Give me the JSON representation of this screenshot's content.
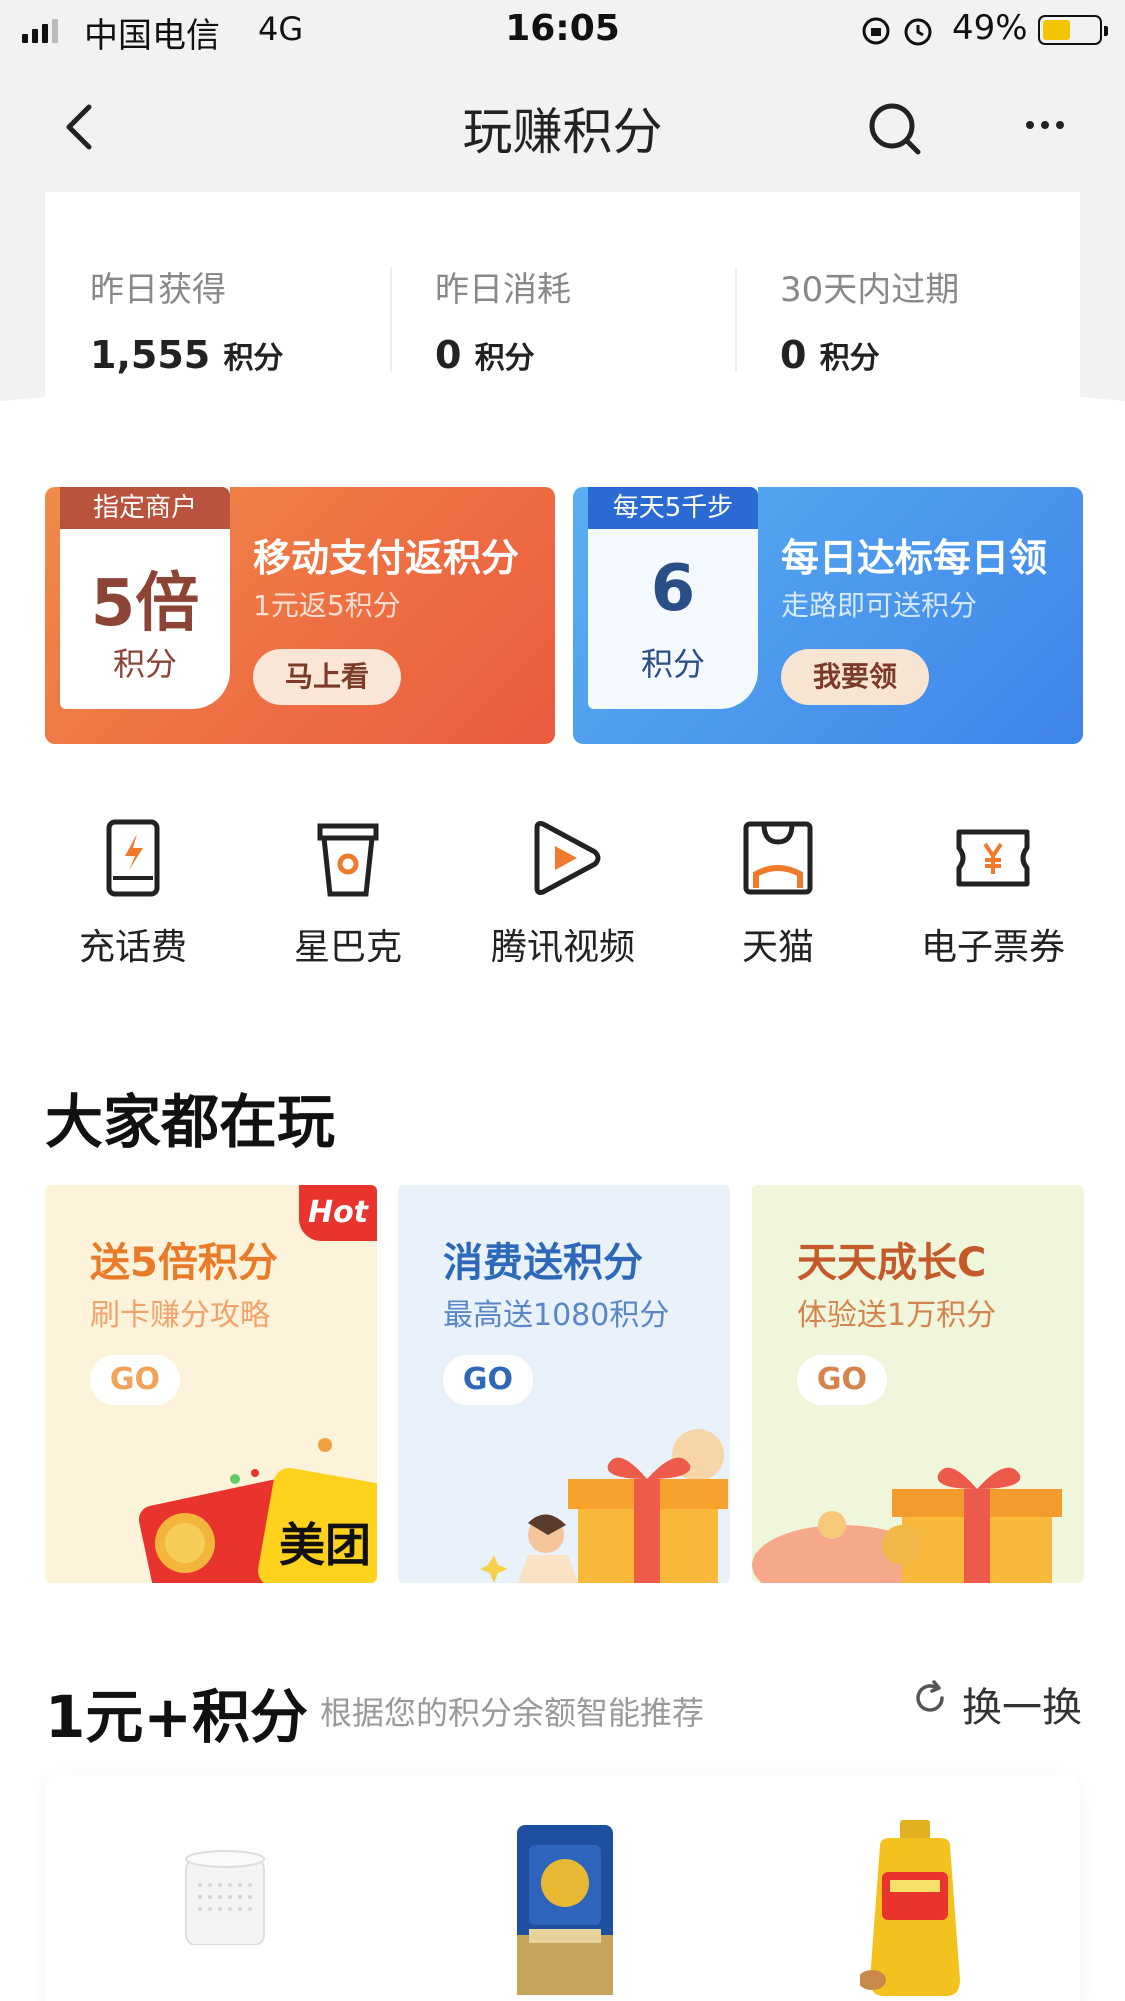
{
  "status_bar": {
    "carrier": "中国电信",
    "network": "4G",
    "time": "16:05",
    "battery_percent": "49%",
    "battery_level": 0.49
  },
  "nav": {
    "title": "玩赚积分",
    "back_icon": "chevron-left-icon",
    "search_icon": "search-icon",
    "more_icon": "more-dots-icon"
  },
  "stats": [
    {
      "label": "昨日获得",
      "value": "1,555",
      "unit": "积分"
    },
    {
      "label": "昨日消耗",
      "value": "0",
      "unit": "积分"
    },
    {
      "label": "30天内过期",
      "value": "0",
      "unit": "积分"
    }
  ],
  "promos": [
    {
      "tag": "指定商户",
      "big": "5倍",
      "unit": "积分",
      "title": "移动支付返积分",
      "subtitle": "1元返5积分",
      "button": "马上看"
    },
    {
      "tag": "每天5千步",
      "big": "6",
      "unit": "积分",
      "title": "每日达标每日领",
      "subtitle": "走路即可送积分",
      "button": "我要领"
    }
  ],
  "quick": [
    {
      "label": "充话费",
      "icon": "phone-charge-icon"
    },
    {
      "label": "星巴克",
      "icon": "coffee-cup-icon"
    },
    {
      "label": "腾讯视频",
      "icon": "video-play-icon"
    },
    {
      "label": "天猫",
      "icon": "tmall-bag-icon"
    },
    {
      "label": "电子票券",
      "icon": "ticket-icon"
    }
  ],
  "section_play": {
    "title": "大家都在玩",
    "cards": [
      {
        "title": "送5倍积分",
        "subtitle": "刷卡赚分攻略",
        "go": "GO",
        "badge": "Hot",
        "art_text": "美团"
      },
      {
        "title": "消费送积分",
        "subtitle": "最高送1080积分",
        "go": "GO"
      },
      {
        "title": "天天成长C",
        "subtitle": "体验送1万积分",
        "go": "GO"
      }
    ]
  },
  "section_recommend": {
    "title": "1元+积分",
    "subtitle": "根据您的积分余额智能推荐",
    "refresh_label": "换一换",
    "refresh_icon": "refresh-icon",
    "products": [
      {
        "name": "smart-speaker"
      },
      {
        "name": "rice-bag"
      },
      {
        "name": "cooking-oil"
      }
    ]
  },
  "colors": {
    "orange_card": "#ec5a3d",
    "blue_card": "#3e84ea",
    "icon_accent": "#f07a2b",
    "hot_badge": "#e8342c"
  }
}
